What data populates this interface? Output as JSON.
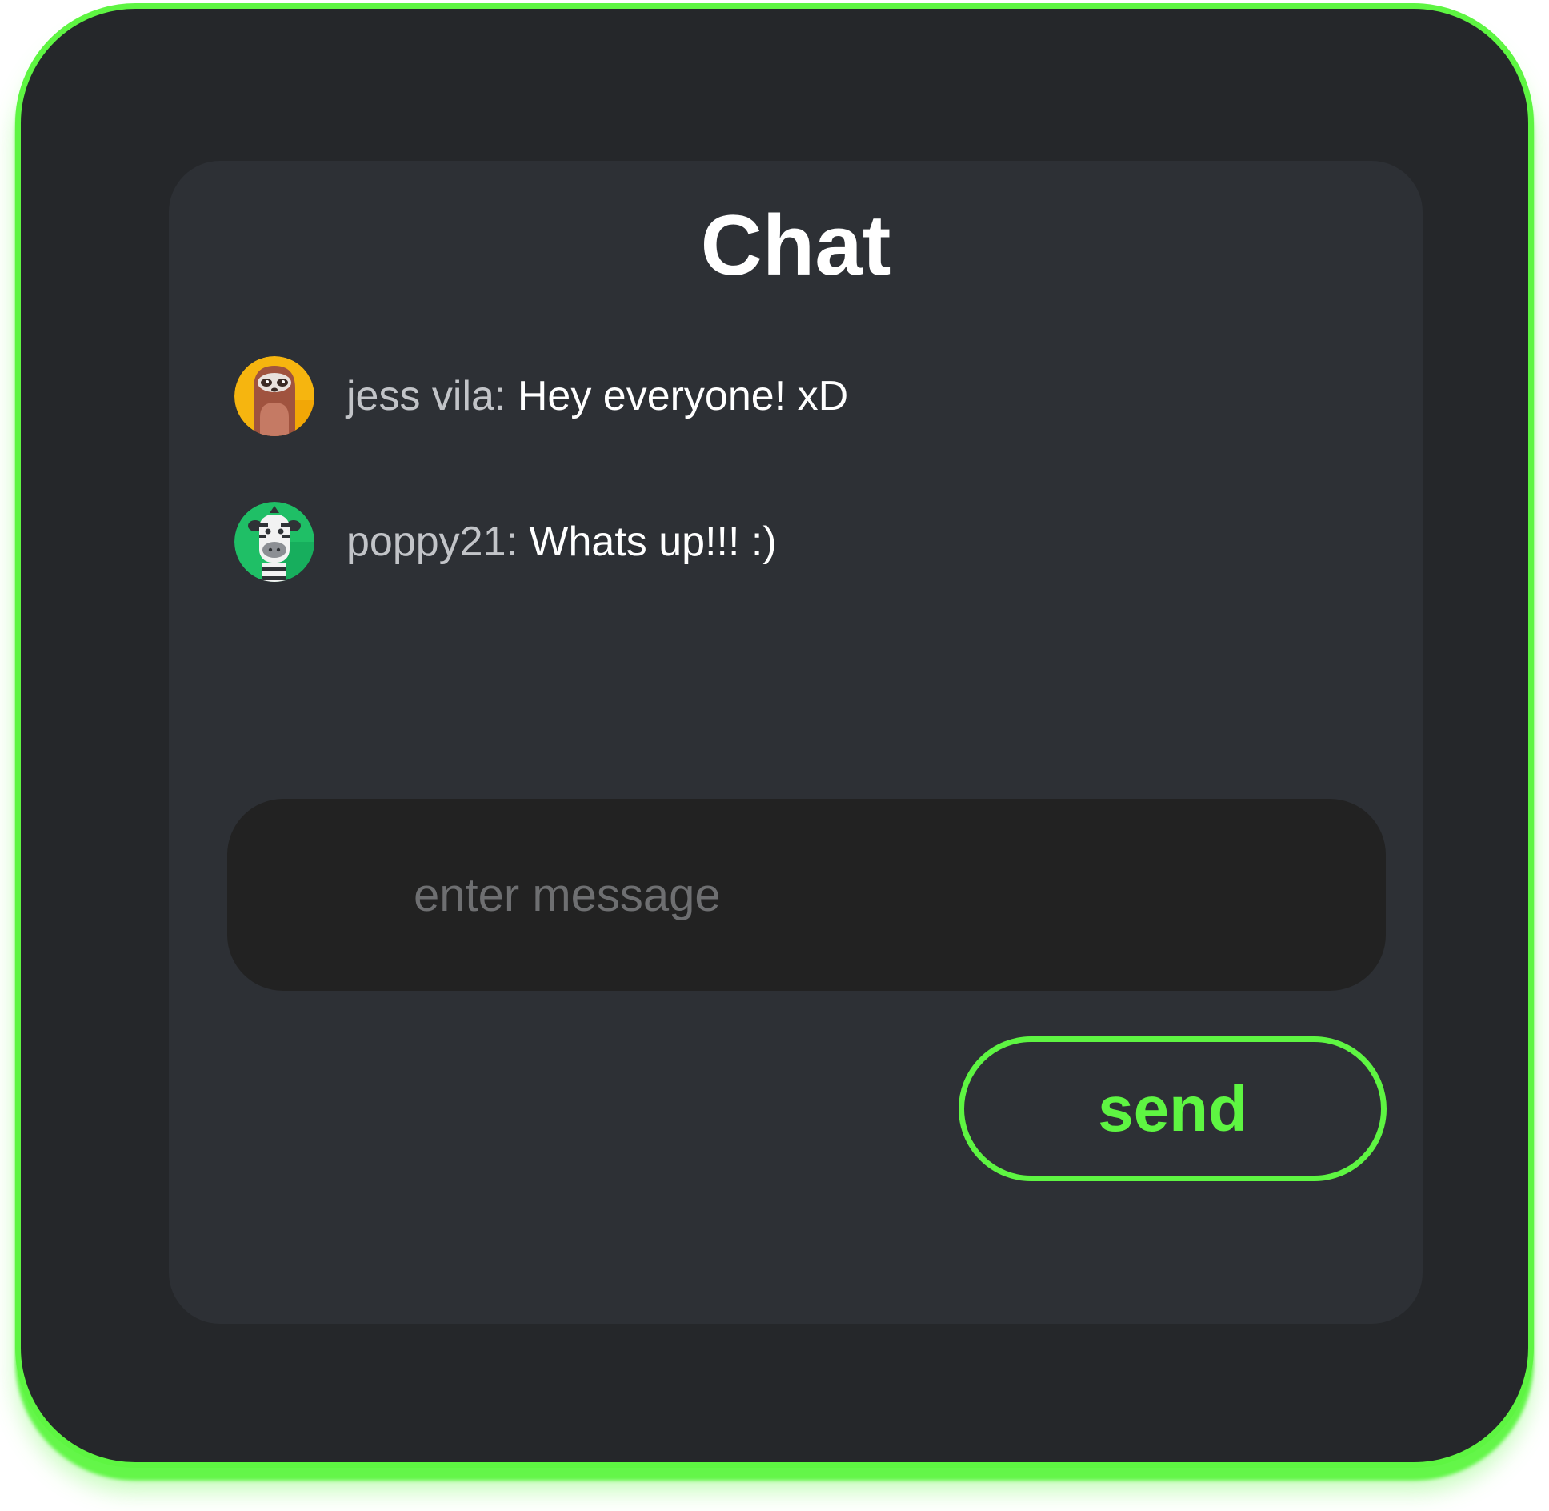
{
  "chat": {
    "title": "Chat",
    "messages": [
      {
        "user": "jess vila:",
        "text": "Hey everyone! xD",
        "avatar_icon": "sloth-avatar-icon"
      },
      {
        "user": "poppy21:",
        "text": "Whats up!!! :)",
        "avatar_icon": "zebra-avatar-icon"
      }
    ],
    "input": {
      "placeholder": "enter message",
      "value": ""
    },
    "send_label": "send"
  },
  "colors": {
    "accent": "#5ef542",
    "frame_background": "#25272a",
    "panel_background": "#2d3035",
    "input_background": "#222222",
    "username_text": "#c2c4c8",
    "message_text": "#ffffff",
    "placeholder_text": "#6e6f71"
  }
}
